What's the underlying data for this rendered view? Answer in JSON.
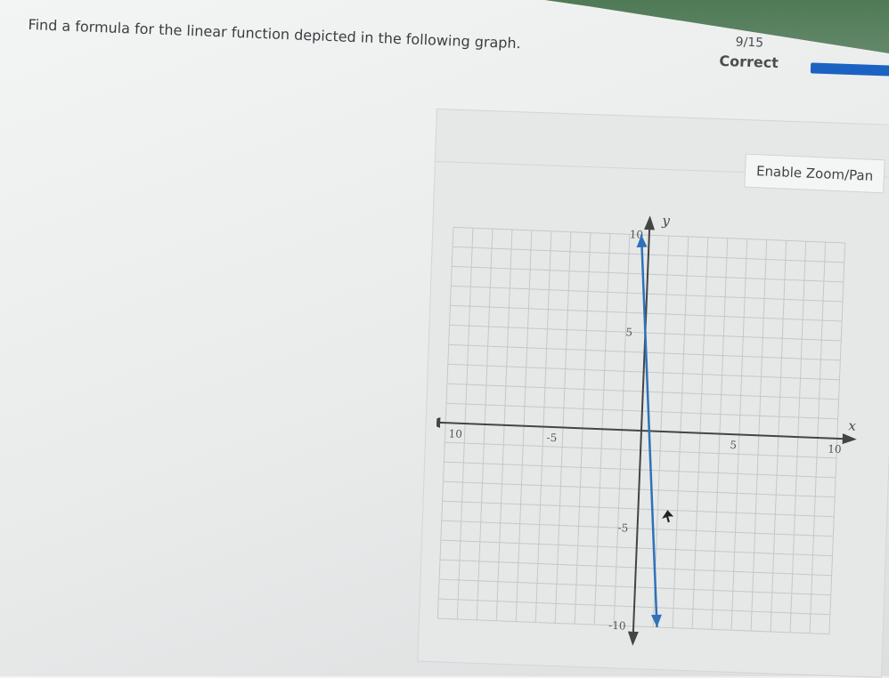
{
  "question": {
    "text": "Find a formula for the linear function depicted in the following graph."
  },
  "status": {
    "count": "9/15",
    "result": "Correct"
  },
  "zoom_button": {
    "label": "Enable Zoom/Pan"
  },
  "colors": {
    "accent": "#1b63c2",
    "line": "#2f72b8"
  },
  "chart_data": {
    "type": "line",
    "title": "",
    "xlabel": "x",
    "ylabel": "y",
    "xlim": [
      -10,
      10
    ],
    "ylim": [
      -10,
      10
    ],
    "grid": true,
    "x_ticks": [
      {
        "value": -10,
        "label": "10"
      },
      {
        "value": -5,
        "label": "-5"
      },
      {
        "value": 5,
        "label": "5"
      },
      {
        "value": 10,
        "label": "10"
      }
    ],
    "y_ticks": [
      {
        "value": 10,
        "label": "10"
      },
      {
        "value": 5,
        "label": "5"
      },
      {
        "value": -5,
        "label": "-5"
      },
      {
        "value": -10,
        "label": "-10"
      }
    ],
    "series": [
      {
        "points": [
          {
            "x": -0.4,
            "y": 10
          },
          {
            "x": 1.2,
            "y": -10
          }
        ]
      }
    ],
    "annotations": [
      {
        "type": "cursor",
        "x": 1.5,
        "y": -4
      }
    ]
  }
}
